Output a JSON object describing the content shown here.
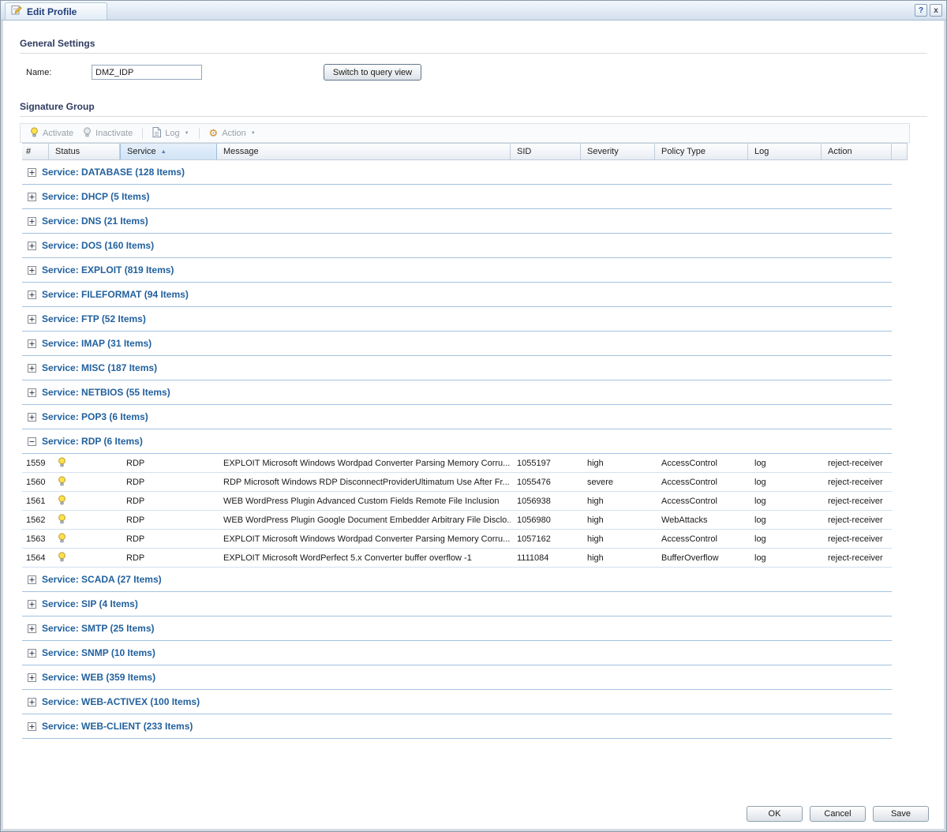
{
  "window": {
    "title": "Edit Profile",
    "help_label": "?",
    "close_label": "x"
  },
  "general": {
    "section_title": "General Settings",
    "name_label": "Name:",
    "name_value": "DMZ_IDP",
    "switch_button_label": "Switch to query view"
  },
  "signature": {
    "section_title": "Signature Group",
    "toolbar": [
      {
        "label": "Activate",
        "icon": "bulb-on-icon",
        "dropdown": false
      },
      {
        "label": "Inactivate",
        "icon": "bulb-off-icon",
        "dropdown": false
      },
      {
        "label": "Log",
        "icon": "log-icon",
        "dropdown": true
      },
      {
        "label": "Action",
        "icon": "gear-icon",
        "dropdown": true
      }
    ],
    "columns": [
      "#",
      "Status",
      "Service",
      "Message",
      "SID",
      "Severity",
      "Policy Type",
      "Log",
      "Action"
    ],
    "sorted_column": "Service",
    "sort_direction": "asc",
    "groups": [
      {
        "label": "Service: DATABASE (128 Items)",
        "expanded": false
      },
      {
        "label": "Service: DHCP (5 Items)",
        "expanded": false
      },
      {
        "label": "Service: DNS (21 Items)",
        "expanded": false
      },
      {
        "label": "Service: DOS (160 Items)",
        "expanded": false
      },
      {
        "label": "Service: EXPLOIT (819 Items)",
        "expanded": false
      },
      {
        "label": "Service: FILEFORMAT (94 Items)",
        "expanded": false
      },
      {
        "label": "Service: FTP (52 Items)",
        "expanded": false
      },
      {
        "label": "Service: IMAP (31 Items)",
        "expanded": false
      },
      {
        "label": "Service: MISC (187 Items)",
        "expanded": false
      },
      {
        "label": "Service: NETBIOS (55 Items)",
        "expanded": false
      },
      {
        "label": "Service: POP3 (6 Items)",
        "expanded": false
      },
      {
        "label": "Service: RDP (6 Items)",
        "expanded": true,
        "rows": [
          {
            "num": "1559",
            "status": "active",
            "service": "RDP",
            "message": "EXPLOIT Microsoft Windows Wordpad Converter Parsing Memory Corru...",
            "sid": "1055197",
            "severity": "high",
            "policy_type": "AccessControl",
            "log": "log",
            "action": "reject-receiver"
          },
          {
            "num": "1560",
            "status": "active",
            "service": "RDP",
            "message": "RDP Microsoft Windows RDP DisconnectProviderUltimatum Use After Fr...",
            "sid": "1055476",
            "severity": "severe",
            "policy_type": "AccessControl",
            "log": "log",
            "action": "reject-receiver"
          },
          {
            "num": "1561",
            "status": "active",
            "service": "RDP",
            "message": "WEB WordPress Plugin Advanced Custom Fields Remote File Inclusion",
            "sid": "1056938",
            "severity": "high",
            "policy_type": "AccessControl",
            "log": "log",
            "action": "reject-receiver"
          },
          {
            "num": "1562",
            "status": "active",
            "service": "RDP",
            "message": "WEB WordPress Plugin Google Document Embedder Arbitrary File Disclo...",
            "sid": "1056980",
            "severity": "high",
            "policy_type": "WebAttacks",
            "log": "log",
            "action": "reject-receiver"
          },
          {
            "num": "1563",
            "status": "active",
            "service": "RDP",
            "message": "EXPLOIT Microsoft Windows Wordpad Converter Parsing Memory Corru...",
            "sid": "1057162",
            "severity": "high",
            "policy_type": "AccessControl",
            "log": "log",
            "action": "reject-receiver"
          },
          {
            "num": "1564",
            "status": "active",
            "service": "RDP",
            "message": "EXPLOIT Microsoft WordPerfect 5.x Converter buffer overflow -1",
            "sid": "1111084",
            "severity": "high",
            "policy_type": "BufferOverflow",
            "log": "log",
            "action": "reject-receiver"
          }
        ]
      },
      {
        "label": "Service: SCADA (27 Items)",
        "expanded": false
      },
      {
        "label": "Service: SIP (4 Items)",
        "expanded": false
      },
      {
        "label": "Service: SMTP (25 Items)",
        "expanded": false
      },
      {
        "label": "Service: SNMP (10 Items)",
        "expanded": false
      },
      {
        "label": "Service: WEB (359 Items)",
        "expanded": false
      },
      {
        "label": "Service: WEB-ACTIVEX (100 Items)",
        "expanded": false
      },
      {
        "label": "Service: WEB-CLIENT (233 Items)",
        "expanded": false
      }
    ]
  },
  "footer": {
    "ok_label": "OK",
    "cancel_label": "Cancel",
    "save_label": "Save"
  },
  "colors": {
    "accent_blue": "#22619e",
    "header_selected": "#d2e4f6",
    "group_border": "#a3c2e0",
    "bulb_yellow": "#ffe14d"
  }
}
